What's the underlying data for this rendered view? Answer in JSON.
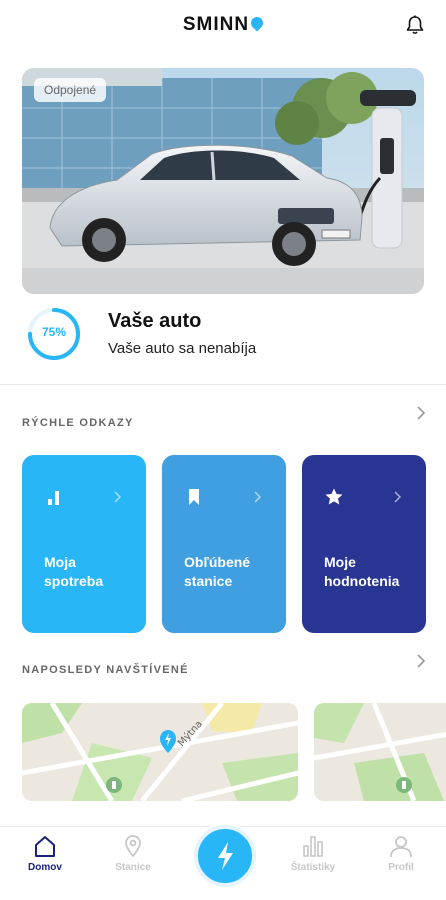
{
  "header": {
    "logo_text": "SMINN",
    "logo_icon": "pin-icon",
    "bell_icon": "bell-icon"
  },
  "vehicle": {
    "status_badge": "Odpojené",
    "charge_percent": 75,
    "charge_label": "75%",
    "title": "Vaše auto",
    "subtitle": "Vaše auto sa nenabíja"
  },
  "quick_links": {
    "title": "RÝCHLE ODKAZY",
    "cards": [
      {
        "label": "Moja spotreba",
        "icon": "bar-chart-icon",
        "color": "#29b6f6"
      },
      {
        "label": "Obľúbené stanice",
        "icon": "bookmark-icon",
        "color": "#3f9fe0"
      },
      {
        "label": "Moje hodnotenia",
        "icon": "star-icon",
        "color": "#283593"
      }
    ]
  },
  "recent": {
    "title": "NAPOSLEDY NAVŠTÍVENÉ",
    "map_street": "Mýtna"
  },
  "tabbar": {
    "items": [
      {
        "label": "Domov",
        "icon": "home-icon",
        "active": true
      },
      {
        "label": "Stanice",
        "icon": "location-pin-icon",
        "active": false
      },
      {
        "label": "",
        "icon": "lightning-icon",
        "active": false
      },
      {
        "label": "Štatistiky",
        "icon": "statistics-icon",
        "active": false
      },
      {
        "label": "Profil",
        "icon": "user-icon",
        "active": false
      }
    ]
  },
  "colors": {
    "accent": "#29b6f6",
    "navy": "#1a237e",
    "card1": "#29b6f6",
    "card2": "#3f9fe0",
    "card3": "#283593"
  }
}
